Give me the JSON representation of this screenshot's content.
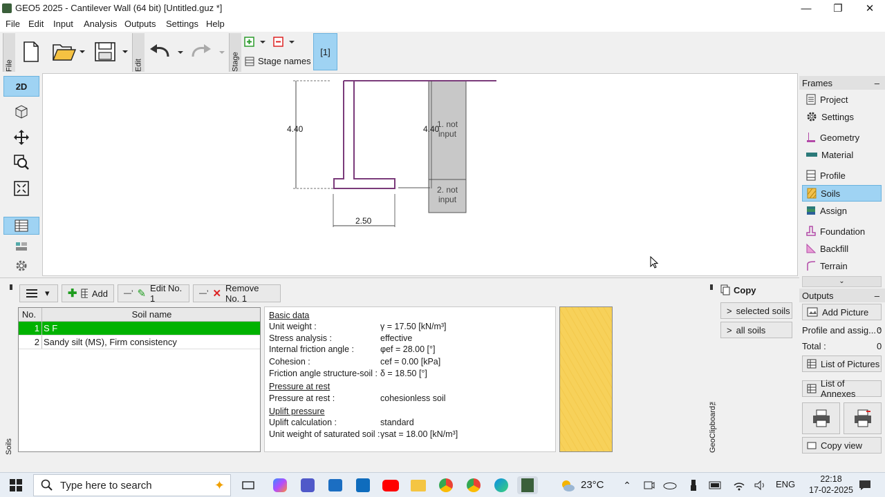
{
  "window": {
    "title": "GEO5 2025 - Cantilever Wall (64 bit) [Untitled.guz *]",
    "minimize_icon": "minimize-icon",
    "restore_icon": "restore-icon",
    "close_icon": "close-icon"
  },
  "menu": [
    "File",
    "Edit",
    "Input",
    "Analysis",
    "Outputs",
    "Settings",
    "Help"
  ],
  "toolbar": {
    "file_tab": "File",
    "edit_tab": "Edit",
    "stage_tab": "Stage",
    "stage_names": "Stage names",
    "stage_1": "[1]"
  },
  "drawing": {
    "height_left": "4.40",
    "height_right": "4.40",
    "width": "2.50",
    "layer1_line1": "1. not",
    "layer1_line2": "input",
    "layer2_line1": "2. not",
    "layer2_line2": "input"
  },
  "frames": {
    "header": "Frames",
    "items": [
      "Project",
      "Settings",
      "Geometry",
      "Material",
      "Profile",
      "Soils",
      "Assign",
      "Foundation",
      "Backfill",
      "Terrain"
    ],
    "selected": "Soils"
  },
  "outputs": {
    "header": "Outputs",
    "add_picture": "Add Picture",
    "profile_label": "Profile and assig... :",
    "profile_count": "0",
    "total_label": "Total :",
    "total_count": "0",
    "list_pictures": "List of Pictures",
    "list_annexes": "List of Annexes",
    "copy_view": "Copy view"
  },
  "soils_panel": {
    "side_label": "Soils",
    "add_button": "Add",
    "edit_button": "Edit No. 1",
    "remove_button": "Remove No. 1",
    "columns": [
      "No.",
      "Soil name"
    ],
    "rows": [
      {
        "no": "1",
        "name": "S F"
      },
      {
        "no": "2",
        "name": "Sandy silt (MS), Firm consistency"
      }
    ]
  },
  "soil_info": {
    "basic_data": "Basic data",
    "unit_weight_label": "Unit weight :",
    "unit_weight_value": "γ = 17.50 [kN/m³]",
    "stress_label": "Stress analysis :",
    "stress_value": "effective",
    "friction_label": "Internal friction angle :",
    "friction_value": "φef = 28.00 [°]",
    "cohesion_label": "Cohesion :",
    "cohesion_value": "cef = 0.00 [kPa]",
    "structure_label": "Friction angle structure-soil :",
    "structure_value": "δ = 18.50 [°]",
    "pressure_rest_header": "Pressure at rest",
    "pressure_rest_label": "Pressure at rest :",
    "pressure_rest_value": "cohesionless soil",
    "uplift_header": "Uplift pressure",
    "uplift_calc_label": "Uplift calculation :",
    "uplift_calc_value": "standard",
    "sat_label": "Unit weight of saturated soil :",
    "sat_value": "γsat = 18.00 [kN/m³]"
  },
  "copy_panel": {
    "title": "Copy",
    "selected_soils": "selected soils",
    "all_soils": "all soils",
    "clipboard_label": "GeoClipboard™"
  },
  "taskbar": {
    "search_placeholder": "Type here to search",
    "temperature": "23°C",
    "language": "ENG",
    "time": "22:18",
    "date": "17-02-2025"
  },
  "colors": {
    "selection": "#9fd3f3",
    "soil_row": "#00b200",
    "wall_outline": "#7a3a7a",
    "soil_swatch": "#f7d15a"
  }
}
